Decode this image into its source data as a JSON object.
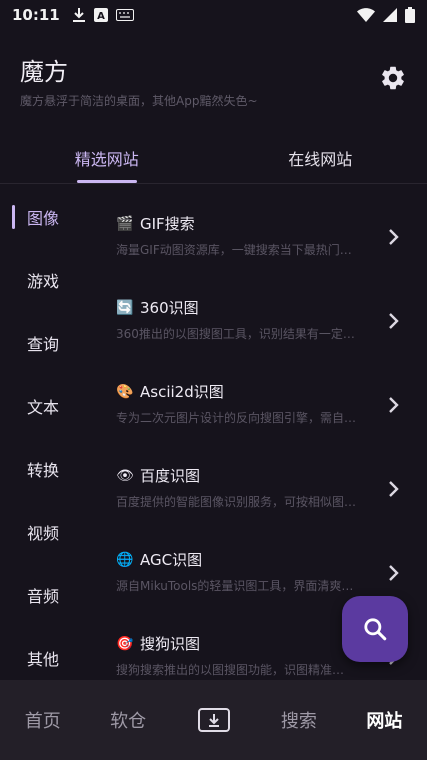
{
  "status_bar": {
    "time": "10:11",
    "left_icons": [
      "download-icon",
      "a-badge-icon",
      "keyboard-icon"
    ],
    "right_icons": [
      "wifi-icon",
      "signal-icon",
      "battery-icon"
    ]
  },
  "header": {
    "title": "魔方",
    "subtitle": "魔方悬浮于简洁的桌面，其他App黯然失色~",
    "settings_icon": "gear-icon"
  },
  "tabs": [
    {
      "label": "精选网站",
      "active": true
    },
    {
      "label": "在线网站",
      "active": false
    }
  ],
  "sidebar": {
    "items": [
      {
        "label": "图像",
        "active": true
      },
      {
        "label": "游戏",
        "active": false
      },
      {
        "label": "查询",
        "active": false
      },
      {
        "label": "文本",
        "active": false
      },
      {
        "label": "转换",
        "active": false
      },
      {
        "label": "视频",
        "active": false
      },
      {
        "label": "音频",
        "active": false
      },
      {
        "label": "其他",
        "active": false
      }
    ]
  },
  "sites": [
    {
      "emoji": "🎬",
      "icon": "clapper-icon",
      "title": "GIF搜索",
      "desc": "海量GIF动图资源库，一键搜索当下最热门…"
    },
    {
      "emoji": "🔄",
      "icon": "refresh-icon",
      "title": "360识图",
      "desc": "360推出的以图搜图工具，识别结果有一定…"
    },
    {
      "emoji": "🎨",
      "icon": "palette-icon",
      "title": "Ascii2d识图",
      "desc": "专为二次元图片设计的反向搜图引擎，需自…"
    },
    {
      "emoji": "👁",
      "icon": "eye-icon",
      "title": "百度识图",
      "desc": "百度提供的智能图像识别服务，可按相似图…"
    },
    {
      "emoji": "🌐",
      "icon": "globe-icon",
      "title": "AGC识图",
      "desc": "源自MikuTools的轻量识图工具，界面清爽…"
    },
    {
      "emoji": "🎯",
      "icon": "target-icon",
      "title": "搜狗识图",
      "desc": "搜狗搜索推出的以图搜图功能，识图精准…"
    }
  ],
  "fab": {
    "icon": "search-icon"
  },
  "bottom_nav": [
    {
      "label": "首页",
      "active": false
    },
    {
      "label": "软仓",
      "active": false
    },
    {
      "label": "",
      "icon": "download-box-icon",
      "active": false
    },
    {
      "label": "搜索",
      "active": false
    },
    {
      "label": "网站",
      "active": true
    }
  ],
  "colors": {
    "background": "#16131c",
    "accent": "#cbb7f2",
    "fab": "#5b3aa0",
    "bottom_bar": "#231f28"
  }
}
